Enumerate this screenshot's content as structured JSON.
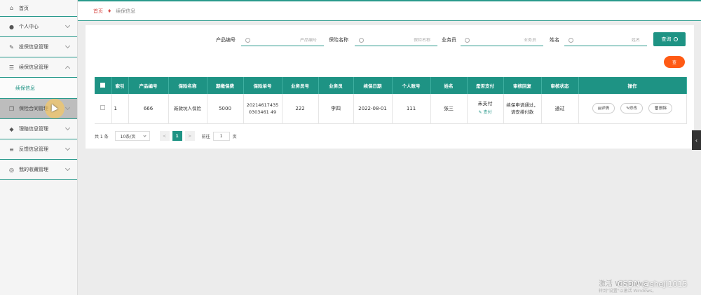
{
  "sidebar": {
    "home": "首页",
    "items": [
      {
        "label": "个人中心",
        "expanded": false
      },
      {
        "label": "投保信息管理",
        "expanded": false
      },
      {
        "label": "续保信息管理",
        "expanded": true,
        "children": [
          "续保信息"
        ]
      },
      {
        "label": "保险合同管理",
        "expanded": false
      },
      {
        "label": "理赔信息管理",
        "expanded": false
      },
      {
        "label": "反馈信息管理",
        "expanded": false
      },
      {
        "label": "我的收藏管理",
        "expanded": false
      }
    ]
  },
  "breadcrumb": {
    "home": "首页",
    "current": "续保信息"
  },
  "search": {
    "fields": [
      {
        "label": "产品编号",
        "placeholder": "产品编号"
      },
      {
        "label": "保险名称",
        "placeholder": "保险名称"
      },
      {
        "label": "业务员",
        "placeholder": "业务员"
      },
      {
        "label": "姓名",
        "placeholder": "姓名"
      }
    ],
    "button": "查询"
  },
  "orange_button": "查",
  "table": {
    "headers": [
      "索引",
      "产品编号",
      "保险名称",
      "期缴保费",
      "保险单号",
      "业务员号",
      "业务员",
      "续保日期",
      "个人账号",
      "姓名",
      "是否支付",
      "审核回复",
      "审核状态",
      "操作"
    ],
    "rows": [
      {
        "index": "1",
        "product_no": "666",
        "insurance_name": "新款坑人保险",
        "premium": "5000",
        "policy_no": "202146174350303461 49",
        "agent_no": "222",
        "agent": "李四",
        "renew_date": "2022-08-01",
        "account": "111",
        "name": "张三",
        "paid": "未支付",
        "pay_link": "支付",
        "reply": "续保申请通过，请安排付款",
        "status": "通过",
        "actions": [
          "详情",
          "修改",
          "删除"
        ]
      }
    ]
  },
  "pager": {
    "total": "共 1 条",
    "page_size": "10条/页",
    "prev": "<",
    "page": "1",
    "next": ">",
    "goto": "前往",
    "goto_value": "1",
    "page_suffix": "页"
  },
  "watermark": {
    "line1": "激活 Windows",
    "line2": "转到\"设置\"以激活 Windows。",
    "csdn": "CSDN @sheji1015"
  },
  "colors": {
    "primary": "#1e9384",
    "accent": "#ff5a14",
    "crumb": "#d9534f"
  }
}
